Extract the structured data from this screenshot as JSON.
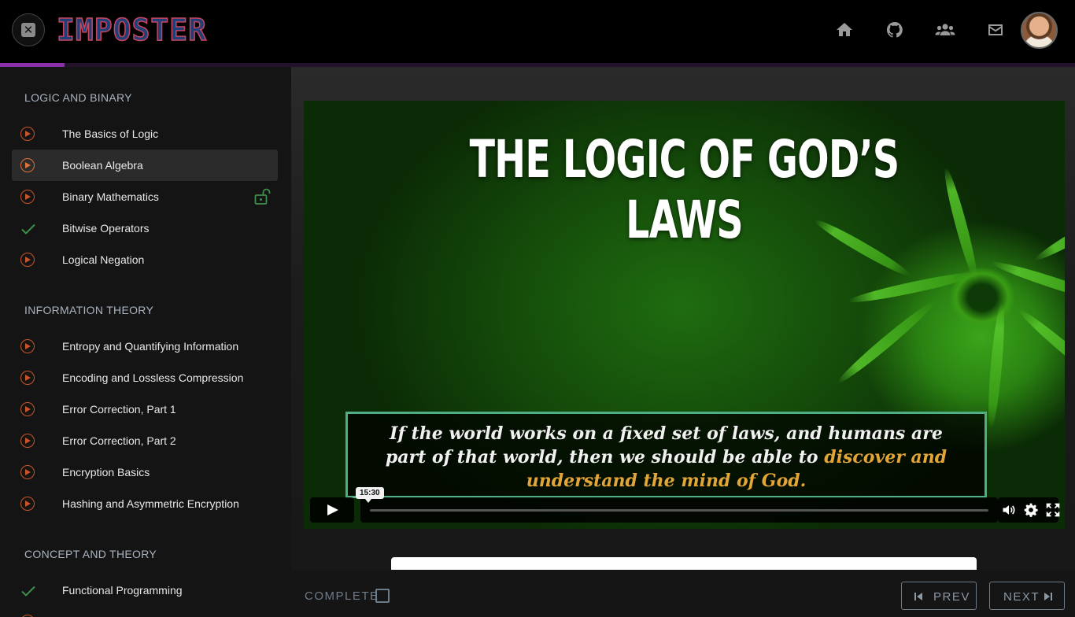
{
  "app": {
    "logo_text": "IMPOSTER",
    "progress_fraction": 0.06
  },
  "header": {
    "close_icon": "close-icon",
    "nav": [
      {
        "name": "home-icon"
      },
      {
        "name": "github-icon"
      },
      {
        "name": "users-icon"
      },
      {
        "name": "mail-icon"
      }
    ]
  },
  "sidebar": {
    "sections": [
      {
        "title": "LOGIC AND BINARY",
        "items": [
          {
            "label": "The Basics of Logic",
            "status": "play"
          },
          {
            "label": "Boolean Algebra",
            "status": "play",
            "active": true
          },
          {
            "label": "Binary Mathematics",
            "status": "play",
            "unlocked": true
          },
          {
            "label": "Bitwise Operators",
            "status": "done"
          },
          {
            "label": "Logical Negation",
            "status": "play"
          }
        ]
      },
      {
        "title": "INFORMATION THEORY",
        "items": [
          {
            "label": "Entropy and Quantifying Information",
            "status": "play"
          },
          {
            "label": "Encoding and Lossless Compression",
            "status": "play"
          },
          {
            "label": "Error Correction, Part 1",
            "status": "play"
          },
          {
            "label": "Error Correction, Part 2",
            "status": "play"
          },
          {
            "label": "Encryption Basics",
            "status": "play"
          },
          {
            "label": "Hashing and Asymmetric Encryption",
            "status": "play"
          }
        ]
      },
      {
        "title": "CONCEPT AND THEORY",
        "items": [
          {
            "label": "Functional Programming",
            "status": "done"
          }
        ]
      }
    ]
  },
  "video": {
    "title": "THE LOGIC OF GOD’S LAWS",
    "quote_line1": "If the world works on a fixed set of laws, and humans are",
    "quote_line2a": "part of that world, then we should be able to ",
    "quote_line2b": "discover and",
    "quote_line3": "understand the mind of God.",
    "hover_time": "15:30",
    "colors": {
      "accent": "#e3a636",
      "frame": "#4fae84"
    }
  },
  "footer": {
    "complete_label": "COMPLETE",
    "prev_label": "PREV",
    "next_label": "NEXT"
  },
  "colors": {
    "brand": "#8b2fa8",
    "icon_orange": "#c8552a",
    "check_green": "#3f8f4c"
  }
}
